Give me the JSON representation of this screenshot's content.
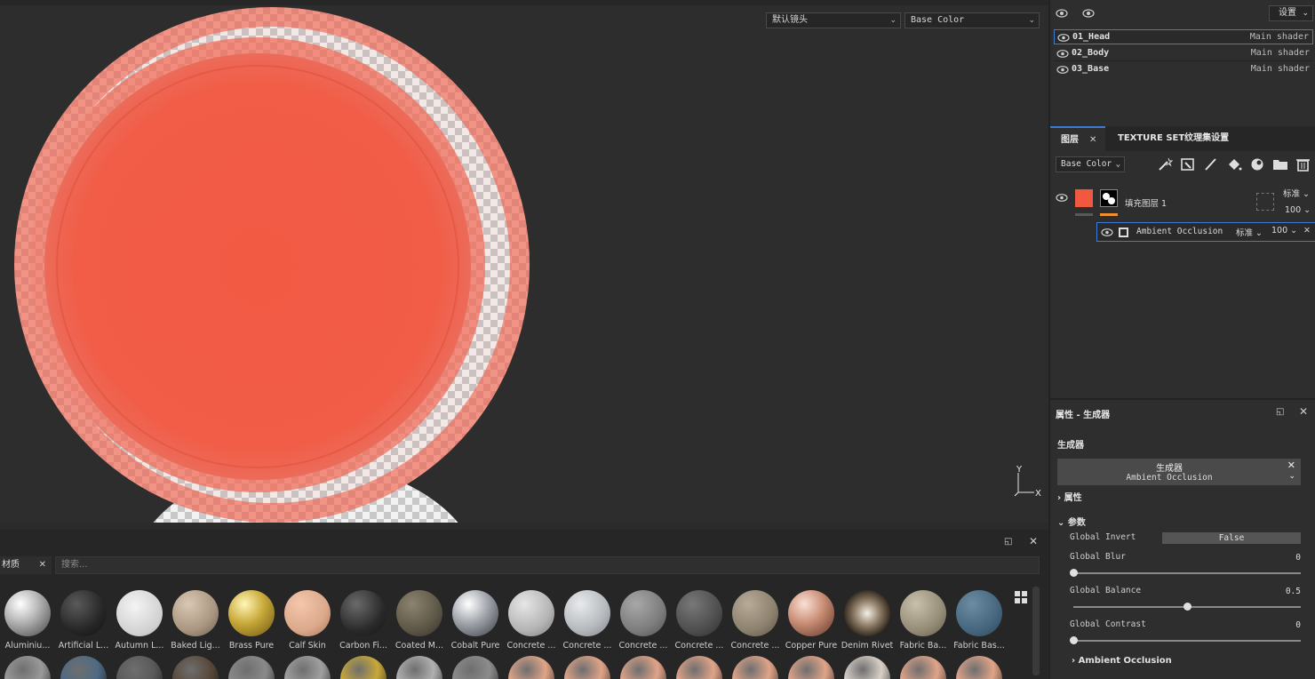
{
  "viewport": {
    "camera_select": "默认镜头",
    "channel_select": "Base Color",
    "axis_x": "X",
    "axis_y": "Y"
  },
  "texture_sets": {
    "settings_label": "设置",
    "rows": [
      {
        "name": "01_Head",
        "shader": "Main shader"
      },
      {
        "name": "02_Body",
        "shader": "Main shader"
      },
      {
        "name": "03_Base",
        "shader": "Main shader"
      }
    ]
  },
  "layers": {
    "tab_layers": "图层",
    "tab_texture_settings": "TEXTURE SET纹理集设置",
    "channel_select": "Base Color",
    "fill_layer": {
      "name": "填充图层 1",
      "blend": "标准",
      "opacity": "100"
    },
    "effect": {
      "name": "Ambient Occlusion",
      "blend": "标准",
      "opacity": "100"
    }
  },
  "properties": {
    "title": "属性 - 生成器",
    "section_generator": "生成器",
    "generator_name": "生成器",
    "generator_type": "Ambient Occlusion",
    "section_attributes": "属性",
    "section_params": "参数",
    "params": {
      "invert_label": "Global Invert",
      "invert_value": "False",
      "blur_label": "Global Blur",
      "blur_value": "0",
      "balance_label": "Global Balance",
      "balance_value": "0.5",
      "contrast_label": "Global Contrast",
      "contrast_value": "0"
    },
    "slider_fraction": {
      "blur": 0,
      "balance": 0.5,
      "contrast": 0
    },
    "section_ao": "Ambient Occlusion"
  },
  "materials": {
    "tab_label": "材质",
    "search_placeholder": "搜索...",
    "items": [
      "Aluminiu...",
      "Artificial L...",
      "Autumn L...",
      "Baked Lig...",
      "Brass Pure",
      "Calf Skin",
      "Carbon Fi...",
      "Coated M...",
      "Cobalt Pure",
      "Concrete ...",
      "Concrete ...",
      "Concrete ...",
      "Concrete ...",
      "Concrete ...",
      "Copper Pure",
      "Denim Rivet",
      "Fabric Ba...",
      "Fabric Bas..."
    ]
  },
  "colors": {
    "accent_orange": "#f0583f",
    "selection_blue": "#3e7bd6"
  }
}
